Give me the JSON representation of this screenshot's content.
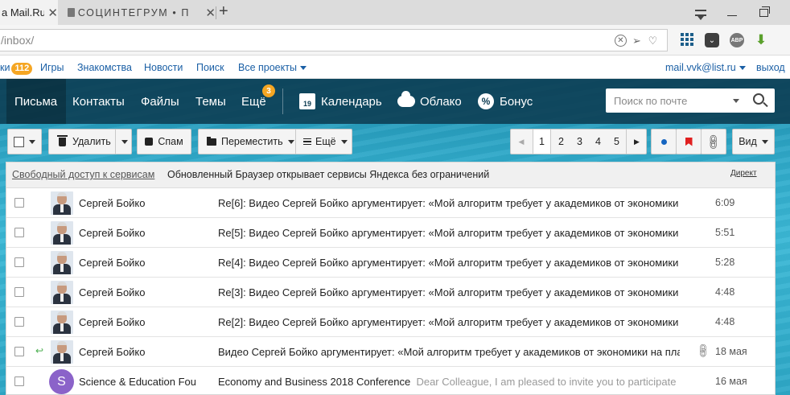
{
  "browser": {
    "active_tab_title": "a Mail.Ru",
    "inactive_tab_title": "СОЦИНТЕГРУМ • П",
    "new_tab": "+",
    "close_glyph": "✕",
    "url": "/inbox/"
  },
  "portal": {
    "mail_label": "ки",
    "mail_count": "112",
    "games": "Игры",
    "dating": "Знакомства",
    "news": "Новости",
    "search": "Поиск",
    "all_projects": "Все проекты",
    "user": "mail.vvk@list.ru",
    "exit": "выход"
  },
  "nav": {
    "letters": "Письма",
    "contacts": "Контакты",
    "files": "Файлы",
    "themes": "Темы",
    "more": "Ещё",
    "more_badge": "3",
    "calendar": "Календарь",
    "calendar_day": "19",
    "cloud": "Облако",
    "bonus": "Бонус",
    "bonus_glyph": "%",
    "search_placeholder": "Поиск по почте"
  },
  "toolbar": {
    "delete": "Удалить",
    "spam": "Спам",
    "move": "Переместить",
    "more": "Ещё",
    "pages": [
      "1",
      "2",
      "3",
      "4",
      "5"
    ],
    "view": "Вид"
  },
  "promo": {
    "link": "Свободный доступ к сервисам",
    "text": "Обновленный Браузер открывает сервисы Яндекса без ограничений",
    "direct": "Директ"
  },
  "messages": [
    {
      "from": "Сергей Бойко",
      "subject": "Re[6]: Видео Сергей Бойко аргументирует: «Мой алгоритм требует у академиков от экономики",
      "snippet": "",
      "time": "6:09"
    },
    {
      "from": "Сергей Бойко",
      "subject": "Re[5]: Видео Сергей Бойко аргументирует: «Мой алгоритм требует у академиков от экономики",
      "snippet": "",
      "time": "5:51"
    },
    {
      "from": "Сергей Бойко",
      "subject": "Re[4]: Видео Сергей Бойко аргументирует: «Мой алгоритм требует у академиков от экономики",
      "snippet": "",
      "time": "5:28"
    },
    {
      "from": "Сергей Бойко",
      "subject": "Re[3]: Видео Сергей Бойко аргументирует: «Мой алгоритм требует у академиков от экономики",
      "snippet": "",
      "time": "4:48"
    },
    {
      "from": "Сергей Бойко",
      "subject": "Re[2]: Видео Сергей Бойко аргументирует: «Мой алгоритм требует у академиков от экономики",
      "snippet": "",
      "time": "4:48"
    },
    {
      "from": "Сергей Бойко",
      "subject": "Видео Сергей Бойко аргументирует: «Мой алгоритм требует у академиков от экономики на пла",
      "snippet": "",
      "time": "18 мая"
    },
    {
      "from": "Science & Education Fou",
      "avatar_letter": "S",
      "subject": "Economy and Business 2018 Conference",
      "snippet": "Dear Colleague, I am pleased to invite you to participate",
      "time": "16 мая"
    }
  ],
  "colors": {
    "nav_bg": "#0d3c52",
    "accent_badge": "#f5a623",
    "link": "#1a5fa5",
    "avatar_purple": "#8b63c9"
  }
}
